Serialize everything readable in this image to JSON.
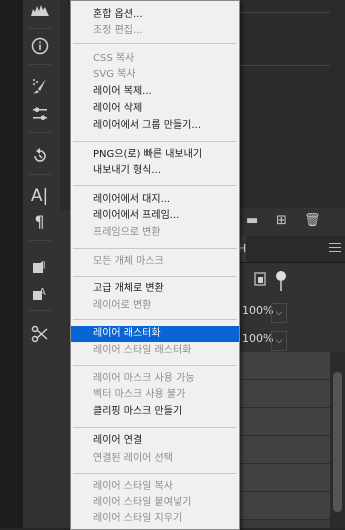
{
  "menu": {
    "items": [
      {
        "label": "혼합 옵션...",
        "enabled": true
      },
      {
        "label": "조정 편집...",
        "enabled": false
      },
      {
        "label": "CSS 복사",
        "enabled": false
      },
      {
        "label": "SVG 복사",
        "enabled": false
      },
      {
        "label": "레이어 복제...",
        "enabled": true
      },
      {
        "label": "레이어 삭제",
        "enabled": true
      },
      {
        "label": "레이어에서 그룹 만들기...",
        "enabled": true
      },
      {
        "label": "PNG으(로) 빠른 내보내기",
        "enabled": true
      },
      {
        "label": "내보내기 형식...",
        "enabled": true
      },
      {
        "label": "레이어에서 대지...",
        "enabled": true
      },
      {
        "label": "레이어에서 프레임...",
        "enabled": true
      },
      {
        "label": "프레임으로 변환",
        "enabled": false
      },
      {
        "label": "모든 개체 마스크",
        "enabled": false
      },
      {
        "label": "고급 개체로 변환",
        "enabled": true
      },
      {
        "label": "레이어로 변환",
        "enabled": false
      },
      {
        "label": "레이어 래스터화",
        "enabled": true,
        "highlighted": true
      },
      {
        "label": "레이어 스타일 래스터화",
        "enabled": false
      },
      {
        "label": "레이어 마스크 사용 가능",
        "enabled": false
      },
      {
        "label": "벡터 마스크 사용 불가",
        "enabled": false
      },
      {
        "label": "클리핑 마스크 만들기",
        "enabled": true
      },
      {
        "label": "레이어 연결",
        "enabled": true
      },
      {
        "label": "연결된 레이어 선택",
        "enabled": false
      },
      {
        "label": "레이어 스타일 복사",
        "enabled": false
      },
      {
        "label": "레이어 스타일 붙여넣기",
        "enabled": false
      },
      {
        "label": "레이어 스타일 지우기",
        "enabled": false
      }
    ]
  },
  "layers_panel": {
    "opacity": "100%",
    "fill": "100%"
  },
  "colors": {
    "highlight": "#0a64d6",
    "menu_bg": "#f0f0f0",
    "panel_bg": "#323232"
  }
}
